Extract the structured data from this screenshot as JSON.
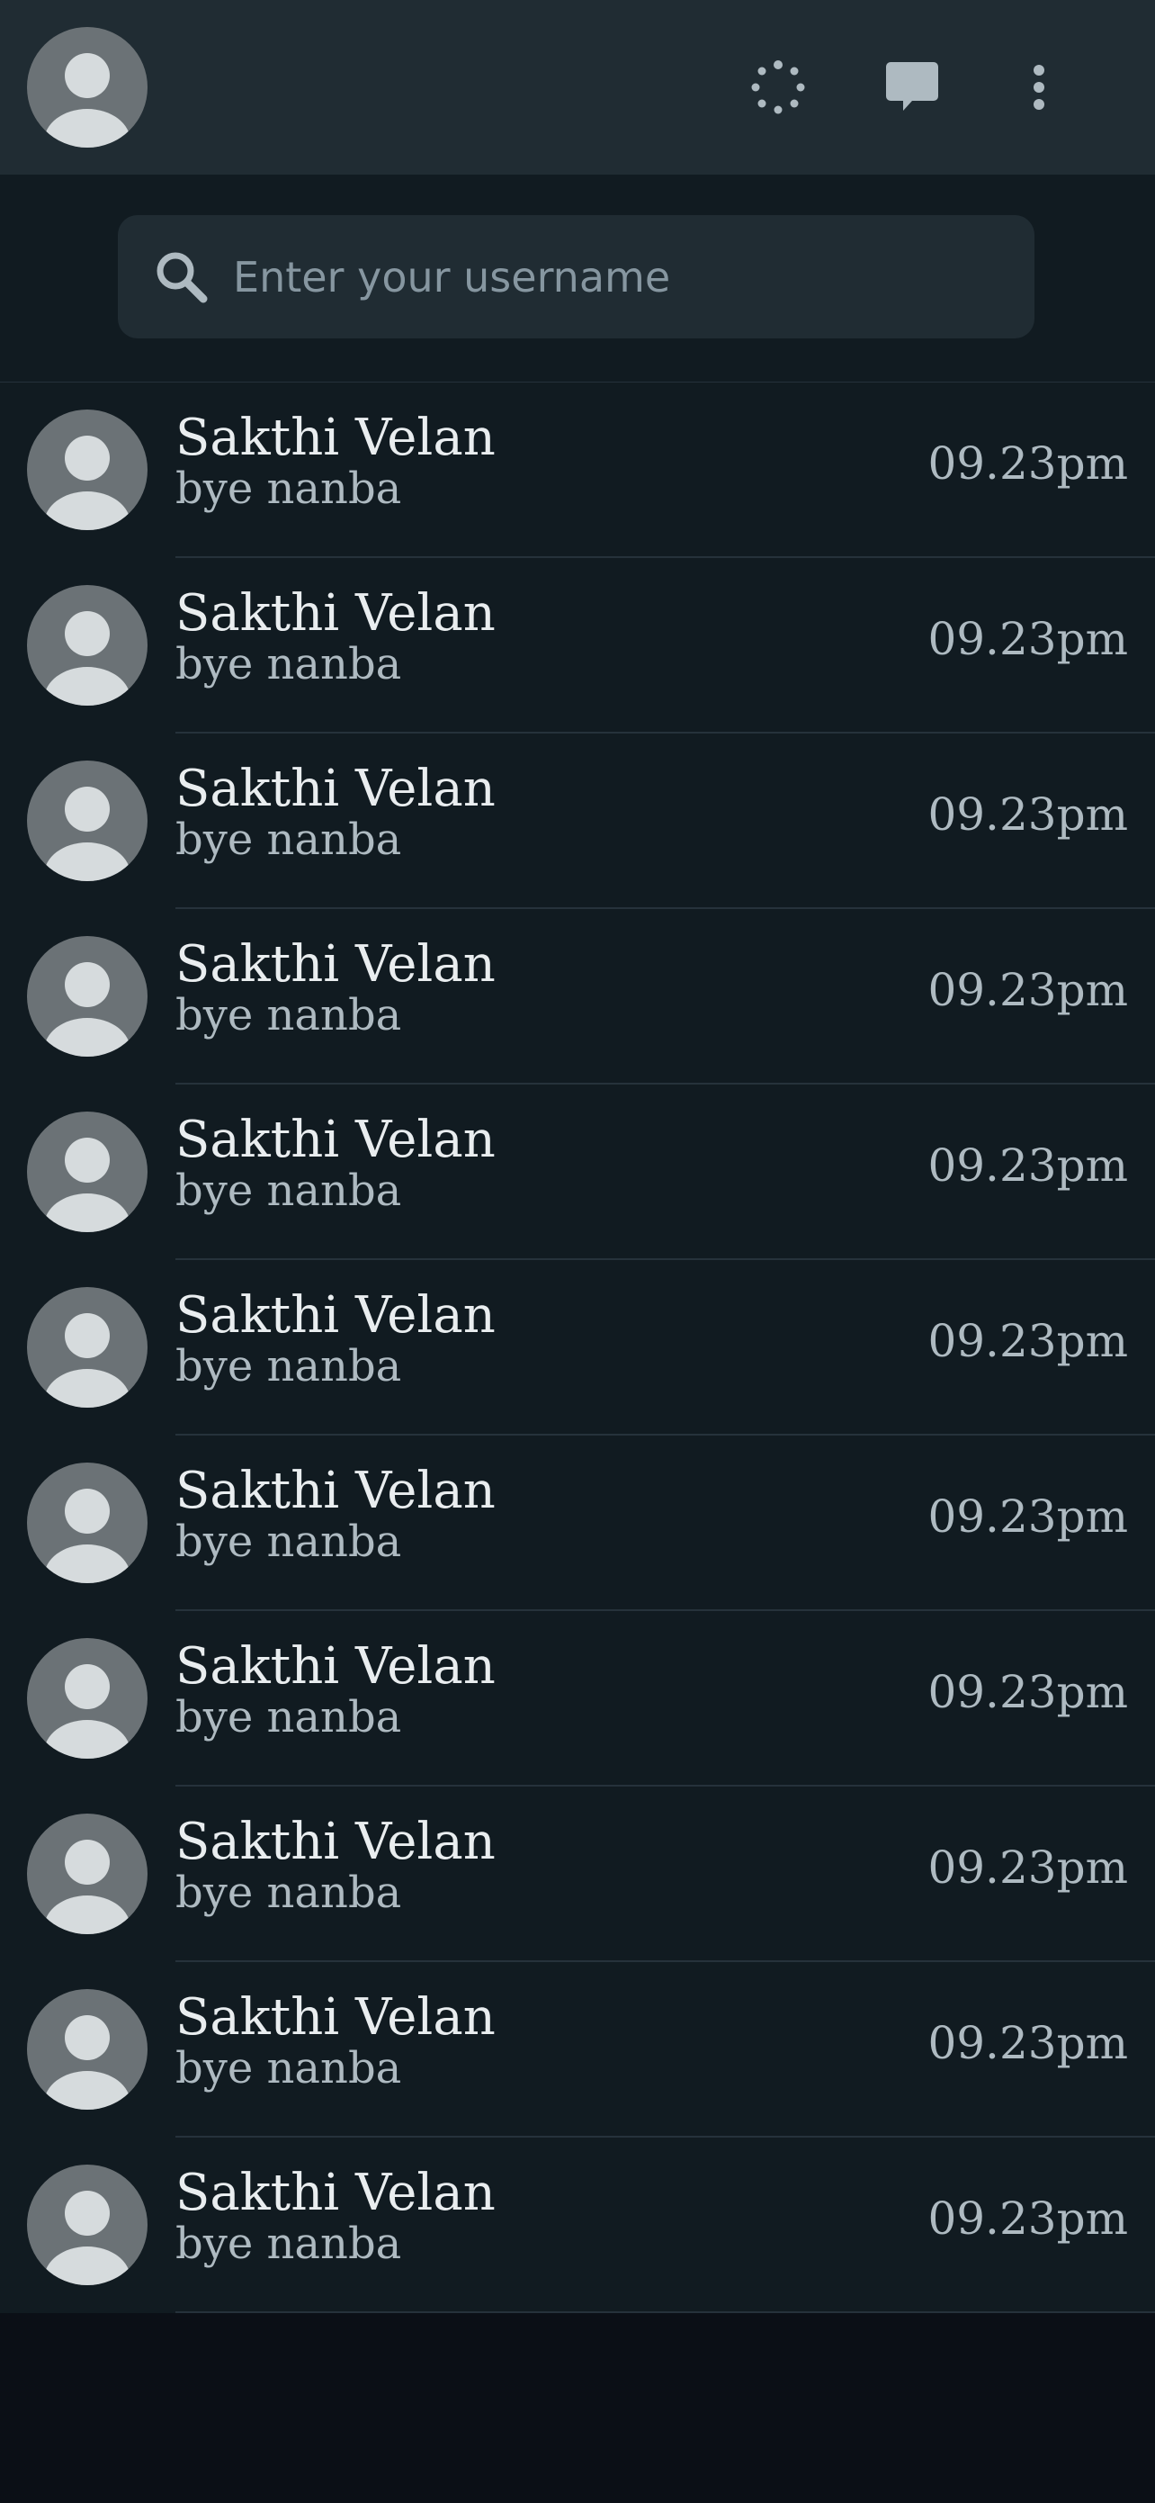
{
  "header": {
    "profile_avatar": "default-person-avatar",
    "icons": {
      "status": "status-ring-icon",
      "new_chat": "chat-bubble-icon",
      "menu": "vertical-dots-icon"
    }
  },
  "search": {
    "placeholder": "Enter your username",
    "value": "",
    "icon": "search-icon"
  },
  "chats": [
    {
      "name": "Sakthi Velan",
      "preview": "bye nanba",
      "time": "09.23pm"
    },
    {
      "name": "Sakthi Velan",
      "preview": "bye nanba",
      "time": "09.23pm"
    },
    {
      "name": "Sakthi Velan",
      "preview": "bye nanba",
      "time": "09.23pm"
    },
    {
      "name": "Sakthi Velan",
      "preview": "bye nanba",
      "time": "09.23pm"
    },
    {
      "name": "Sakthi Velan",
      "preview": "bye nanba",
      "time": "09.23pm"
    },
    {
      "name": "Sakthi Velan",
      "preview": "bye nanba",
      "time": "09.23pm"
    },
    {
      "name": "Sakthi Velan",
      "preview": "bye nanba",
      "time": "09.23pm"
    },
    {
      "name": "Sakthi Velan",
      "preview": "bye nanba",
      "time": "09.23pm"
    },
    {
      "name": "Sakthi Velan",
      "preview": "bye nanba",
      "time": "09.23pm"
    },
    {
      "name": "Sakthi Velan",
      "preview": "bye nanba",
      "time": "09.23pm"
    },
    {
      "name": "Sakthi Velan",
      "preview": "bye nanba",
      "time": "09.23pm"
    }
  ],
  "colors": {
    "header_bg": "#202c33",
    "list_bg": "#111b21",
    "page_bg": "#0b0f16",
    "icon": "#aebac1",
    "primary_text": "#e9edef",
    "secondary_text": "#aebac1"
  }
}
